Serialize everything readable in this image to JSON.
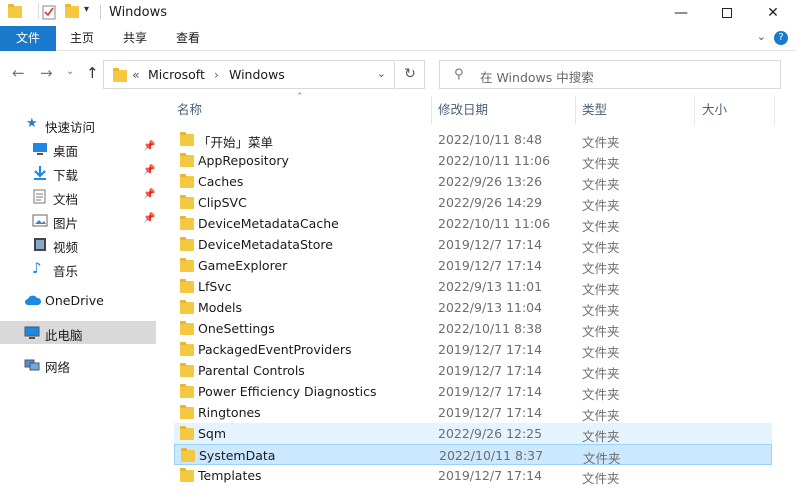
{
  "window": {
    "title": "Windows"
  },
  "ribbon": {
    "tabs": [
      "文件",
      "主页",
      "共享",
      "查看"
    ],
    "help": "?"
  },
  "address": {
    "breadcrumb_overflow": "«",
    "crumbs": [
      "Microsoft",
      "Windows"
    ],
    "separator": "›",
    "search_placeholder": "在 Windows 中搜索"
  },
  "sidebar": {
    "quick_access": {
      "label": "快速访问",
      "icon": "star-icon"
    },
    "items": [
      {
        "label": "桌面",
        "icon": "desktop-icon",
        "pinned": true
      },
      {
        "label": "下载",
        "icon": "download-icon",
        "pinned": true
      },
      {
        "label": "文档",
        "icon": "document-icon",
        "pinned": true
      },
      {
        "label": "图片",
        "icon": "picture-icon",
        "pinned": true
      },
      {
        "label": "视频",
        "icon": "video-icon",
        "pinned": false
      },
      {
        "label": "音乐",
        "icon": "music-icon",
        "pinned": false
      }
    ],
    "onedrive": "OneDrive",
    "this_pc": "此电脑",
    "network": "网络"
  },
  "columns": {
    "name": "名称",
    "date": "修改日期",
    "type": "类型",
    "size": "大小"
  },
  "files": [
    {
      "name": "「开始」菜单",
      "date": "2022/10/11 8:48",
      "type": "文件夹"
    },
    {
      "name": "AppRepository",
      "date": "2022/10/11 11:06",
      "type": "文件夹"
    },
    {
      "name": "Caches",
      "date": "2022/9/26 13:26",
      "type": "文件夹"
    },
    {
      "name": "ClipSVC",
      "date": "2022/9/26 14:29",
      "type": "文件夹"
    },
    {
      "name": "DeviceMetadataCache",
      "date": "2022/10/11 11:06",
      "type": "文件夹"
    },
    {
      "name": "DeviceMetadataStore",
      "date": "2019/12/7 17:14",
      "type": "文件夹"
    },
    {
      "name": "GameExplorer",
      "date": "2019/12/7 17:14",
      "type": "文件夹"
    },
    {
      "name": "LfSvc",
      "date": "2022/9/13 11:01",
      "type": "文件夹"
    },
    {
      "name": "Models",
      "date": "2022/9/13 11:04",
      "type": "文件夹"
    },
    {
      "name": "OneSettings",
      "date": "2022/10/11 8:38",
      "type": "文件夹"
    },
    {
      "name": "PackagedEventProviders",
      "date": "2019/12/7 17:14",
      "type": "文件夹"
    },
    {
      "name": "Parental Controls",
      "date": "2019/12/7 17:14",
      "type": "文件夹"
    },
    {
      "name": "Power Efficiency Diagnostics",
      "date": "2019/12/7 17:14",
      "type": "文件夹"
    },
    {
      "name": "Ringtones",
      "date": "2019/12/7 17:14",
      "type": "文件夹"
    },
    {
      "name": "Sqm",
      "date": "2022/9/26 12:25",
      "type": "文件夹",
      "state": "hover"
    },
    {
      "name": "SystemData",
      "date": "2022/10/11 8:37",
      "type": "文件夹",
      "state": "selected"
    },
    {
      "name": "Templates",
      "date": "2019/12/7 17:14",
      "type": "文件夹"
    }
  ]
}
